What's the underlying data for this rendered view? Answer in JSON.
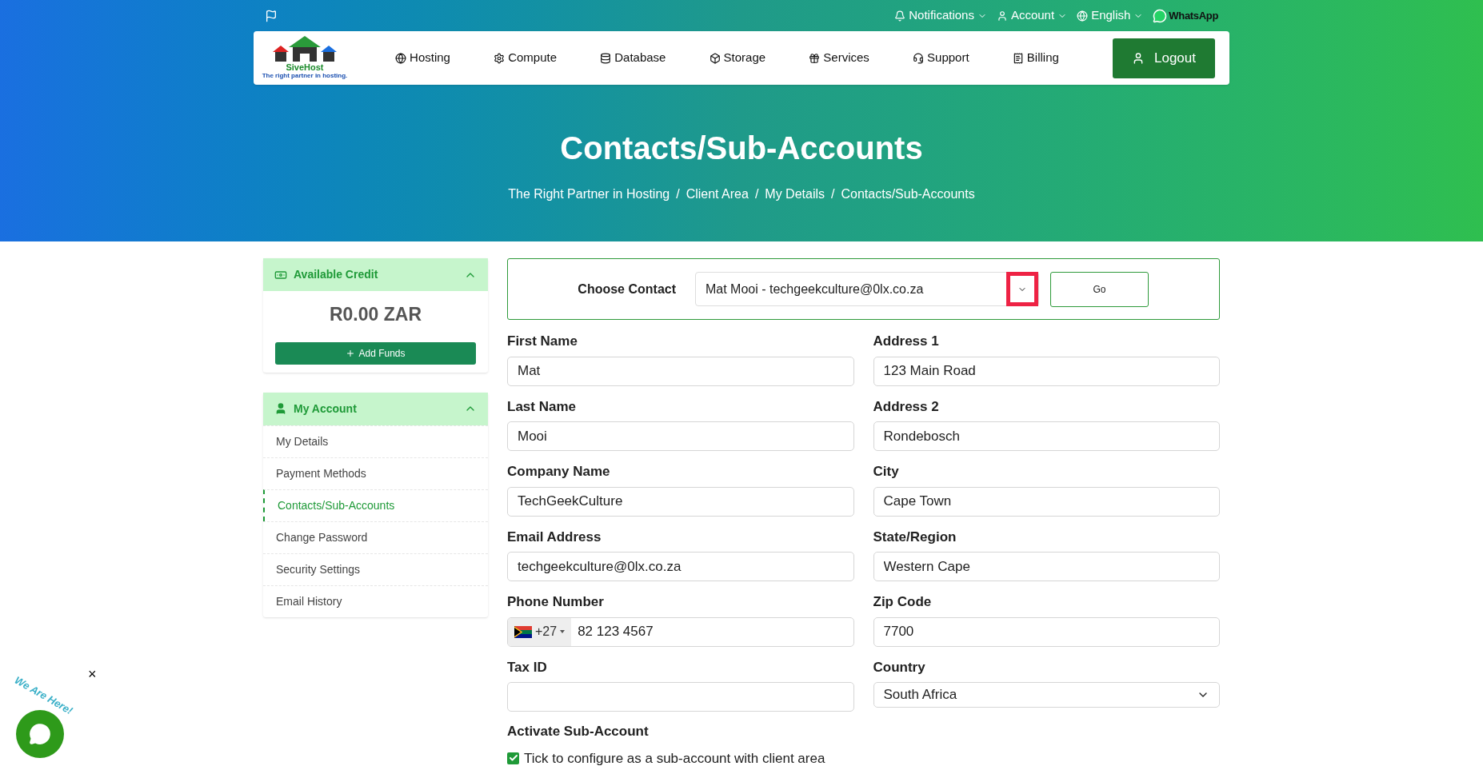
{
  "top_bar": {
    "links": [
      {
        "label": "Notifications"
      },
      {
        "label": "Account"
      },
      {
        "label": "English"
      }
    ],
    "whatsapp": "WhatsApp"
  },
  "logo": {
    "name": "SiveHost",
    "tagline": "The right partner in hosting."
  },
  "nav": {
    "items": [
      {
        "label": "Hosting"
      },
      {
        "label": "Compute"
      },
      {
        "label": "Database"
      },
      {
        "label": "Storage"
      },
      {
        "label": "Services"
      },
      {
        "label": "Support"
      },
      {
        "label": "Billing"
      }
    ],
    "logout": "Logout"
  },
  "hero": {
    "title": "Contacts/Sub-Accounts",
    "separator": "/",
    "breadcrumb": [
      "The Right Partner in Hosting",
      "Client Area",
      "My Details",
      "Contacts/Sub-Accounts"
    ]
  },
  "sidebar": {
    "credit": {
      "title": "Available Credit",
      "expanded": true,
      "amount": "R0.00 ZAR",
      "button": "Add Funds"
    },
    "account": {
      "title": "My Account",
      "expanded": true,
      "items": [
        {
          "label": "My Details",
          "selected": false
        },
        {
          "label": "Payment Methods",
          "selected": false
        },
        {
          "label": "Contacts/Sub-Accounts",
          "selected": true
        },
        {
          "label": "Change Password",
          "selected": false
        },
        {
          "label": "Security Settings",
          "selected": false
        },
        {
          "label": "Email History",
          "selected": false
        }
      ]
    }
  },
  "choose_contact": {
    "label": "Choose Contact",
    "value": "Mat Mooi - techgeekculture@0lx.co.za",
    "caret_highlighted": true,
    "button": "Go"
  },
  "form": {
    "left": [
      {
        "kind": "text",
        "label": "First Name",
        "value": "Mat"
      },
      {
        "kind": "text",
        "label": "Last Name",
        "value": "Mooi"
      },
      {
        "kind": "text",
        "label": "Company Name",
        "value": "TechGeekCulture"
      },
      {
        "kind": "text",
        "label": "Email Address",
        "value": "techgeekculture@0lx.co.za"
      },
      {
        "kind": "phone",
        "label": "Phone Number",
        "code": "+27",
        "value": "82 123 4567"
      },
      {
        "kind": "text",
        "label": "Tax ID"
      }
    ],
    "right": [
      {
        "kind": "text",
        "label": "Address 1",
        "value": "123 Main Road"
      },
      {
        "kind": "text",
        "label": "Address 2",
        "value": "Rondebosch"
      },
      {
        "kind": "text",
        "label": "City",
        "value": "Cape Town"
      },
      {
        "kind": "text",
        "label": "State/Region",
        "value": "Western Cape"
      },
      {
        "kind": "text",
        "label": "Zip Code",
        "value": "7700"
      },
      {
        "kind": "select",
        "label": "Country",
        "value": "South Africa"
      }
    ],
    "sub_account": {
      "title": "Activate Sub-Account",
      "checked": true,
      "label": "Tick to configure as a sub-account with client area"
    }
  },
  "chat_widget": {
    "text": "We Are Here!",
    "close": "×"
  }
}
